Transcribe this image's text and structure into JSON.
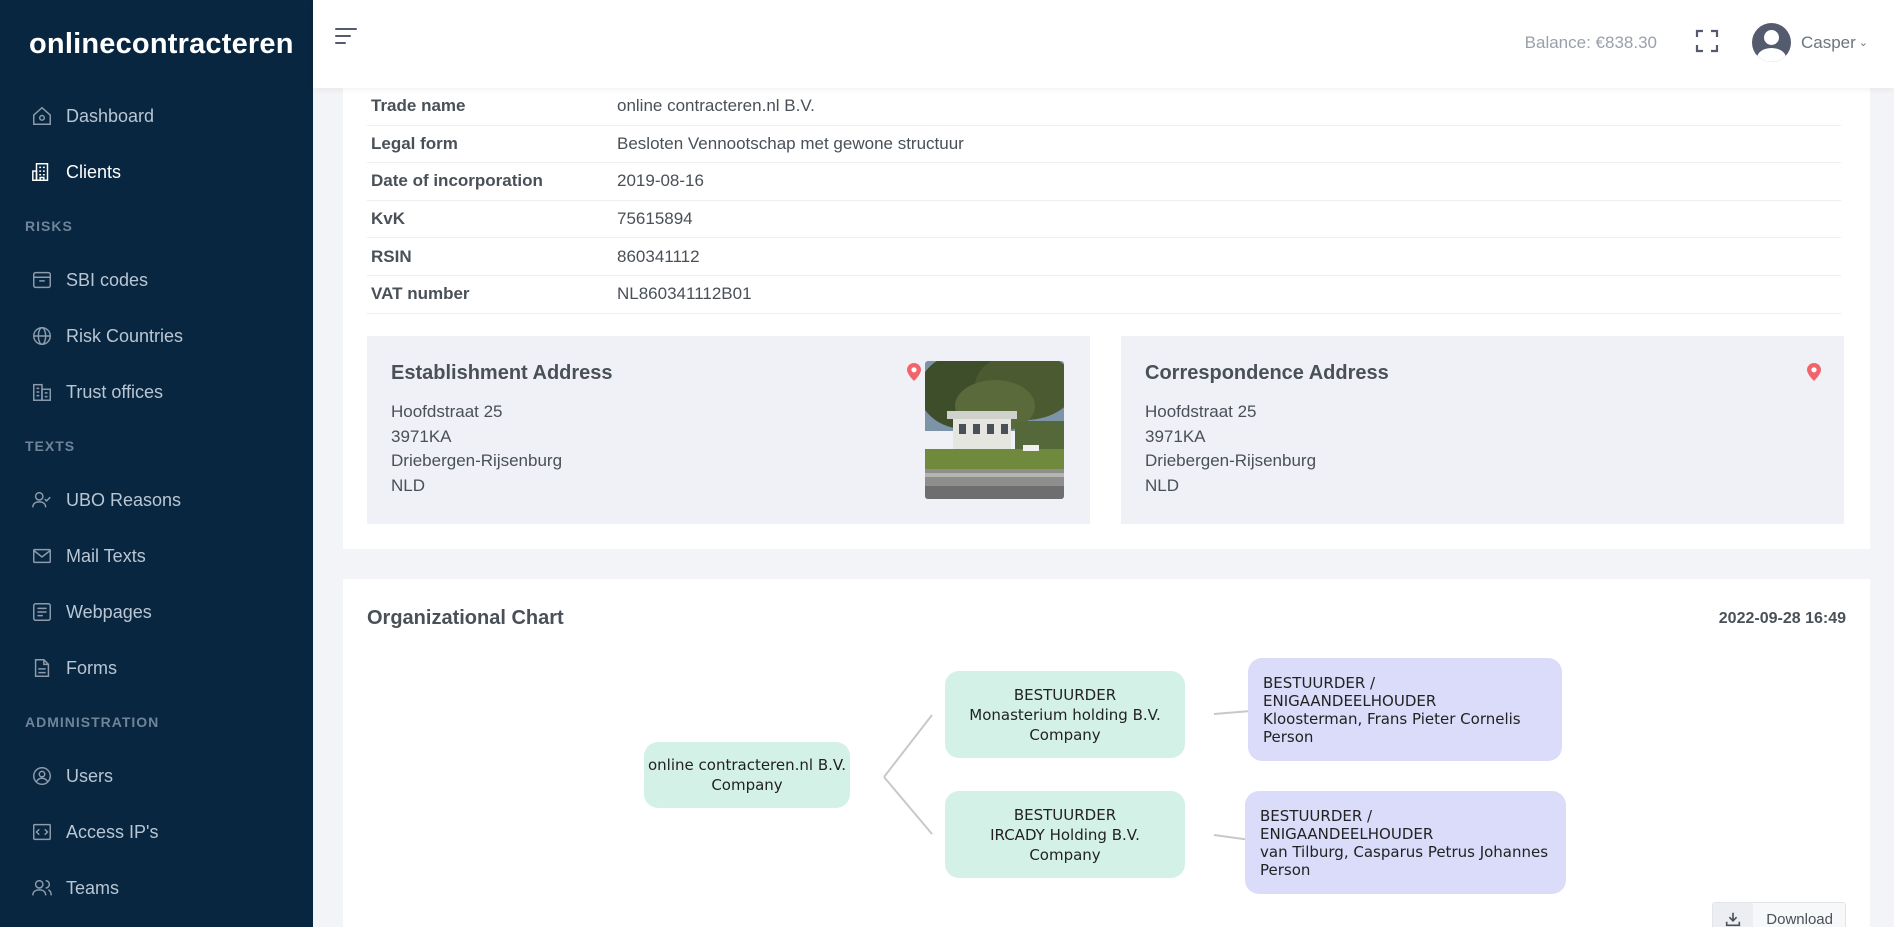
{
  "brand": "onlinecontracteren",
  "sidebar": {
    "items": [
      {
        "label": "Dashboard",
        "icon": "home-icon"
      },
      {
        "label": "Clients",
        "icon": "building-icon",
        "active": true
      }
    ],
    "sections": [
      {
        "title": "RISKS",
        "items": [
          {
            "label": "SBI codes",
            "icon": "archive-icon"
          },
          {
            "label": "Risk Countries",
            "icon": "globe-icon"
          },
          {
            "label": "Trust offices",
            "icon": "buildings-icon"
          }
        ]
      },
      {
        "title": "TEXTS",
        "items": [
          {
            "label": "UBO Reasons",
            "icon": "user-check-icon"
          },
          {
            "label": "Mail Texts",
            "icon": "mail-icon"
          },
          {
            "label": "Webpages",
            "icon": "webpage-icon"
          },
          {
            "label": "Forms",
            "icon": "file-icon"
          }
        ]
      },
      {
        "title": "ADMINISTRATION",
        "items": [
          {
            "label": "Users",
            "icon": "user-circle-icon"
          },
          {
            "label": "Access IP's",
            "icon": "code-icon"
          },
          {
            "label": "Teams",
            "icon": "users-icon"
          }
        ]
      }
    ]
  },
  "topbar": {
    "balance": "Balance: €838.30",
    "user_name": "Casper"
  },
  "company_info": [
    {
      "label": "Trade name",
      "value": "online contracteren.nl B.V."
    },
    {
      "label": "Legal form",
      "value": "Besloten Vennootschap met gewone structuur"
    },
    {
      "label": "Date of incorporation",
      "value": "2019-08-16"
    },
    {
      "label": "KvK",
      "value": "75615894"
    },
    {
      "label": "RSIN",
      "value": "860341112"
    },
    {
      "label": "VAT number",
      "value": "NL860341112B01"
    }
  ],
  "establishment_address": {
    "title": "Establishment Address",
    "street": "Hoofdstraat 25",
    "postal": "3971KA",
    "city": "Driebergen-Rijsenburg",
    "country": "NLD"
  },
  "correspondence_address": {
    "title": "Correspondence Address",
    "street": "Hoofdstraat 25",
    "postal": "3971KA",
    "city": "Driebergen-Rijsenburg",
    "country": "NLD"
  },
  "org_chart": {
    "title": "Organizational Chart",
    "timestamp": "2022-09-28 16:49",
    "root": {
      "name": "online contracteren.nl B.V.",
      "type": "Company"
    },
    "directors": [
      {
        "role": "BESTUURDER",
        "name": "Monasterium holding B.V.",
        "type": "Company",
        "child": {
          "role_line1": "BESTUURDER /",
          "role_line2": "ENIGAANDEELHOUDER",
          "name": "Kloosterman, Frans Pieter Cornelis",
          "type": "Person"
        }
      },
      {
        "role": "BESTUURDER",
        "name": "IRCADY Holding B.V.",
        "type": "Company",
        "child": {
          "role_line1": "BESTUURDER /",
          "role_line2": "ENIGAANDEELHOUDER",
          "name": "van Tilburg, Casparus Petrus Johannes",
          "type": "Person"
        }
      }
    ],
    "download_label": "Download"
  },
  "colors": {
    "sidebar_bg": "#082640",
    "company_node": "#d4f1e7",
    "person_node": "#dadcfa",
    "pin": "#f1646c"
  }
}
